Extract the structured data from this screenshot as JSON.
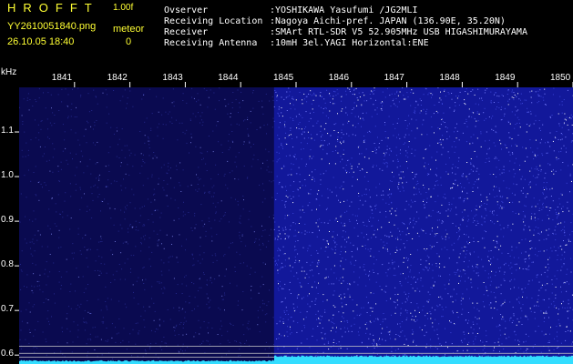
{
  "header": {
    "logo": "HROFFT",
    "version": "1.00f",
    "filename": "YY2610051840.png",
    "datetime": "26.10.05 18:40",
    "meteor_label": "meteor",
    "meteor_count": "0"
  },
  "station": {
    "rows": [
      {
        "label": "Ovserver",
        "value": ":YOSHIKAWA Yasufumi /JG2MLI"
      },
      {
        "label": "Receiving Location",
        "value": ":Nagoya Aichi-pref. JAPAN (136.90E, 35.20N)"
      },
      {
        "label": "Receiver",
        "value": ":SMArt RTL-SDR V5 52.905MHz USB HIGASHIMURAYAMA"
      },
      {
        "label": "Receiving Antenna",
        "value": ":10mH 3el.YAGI Horizontal:ENE"
      }
    ]
  },
  "chart_data": {
    "type": "heatmap",
    "ylabel": "kHz",
    "xlabel": "",
    "time_ticks": [
      "1841",
      "1842",
      "1843",
      "1844",
      "1845",
      "1846",
      "1847",
      "1848",
      "1849",
      "1850"
    ],
    "freq_ticks": [
      1.1,
      1.0,
      0.9,
      0.8,
      0.7,
      0.6
    ],
    "ylim": [
      0.58,
      1.2
    ],
    "xlim": [
      1840.0,
      1850.0
    ],
    "data_gap_end_minute": 1844.6,
    "reference_lines_khz": [
      0.62,
      0.604,
      0.595
    ],
    "colors": {
      "background_low": "#0a0a50",
      "background_high": "#12189a",
      "noise_speck": "#ffffff",
      "spectrum_trace": "#33ddff",
      "reference_line": "#c8c8c8"
    }
  }
}
